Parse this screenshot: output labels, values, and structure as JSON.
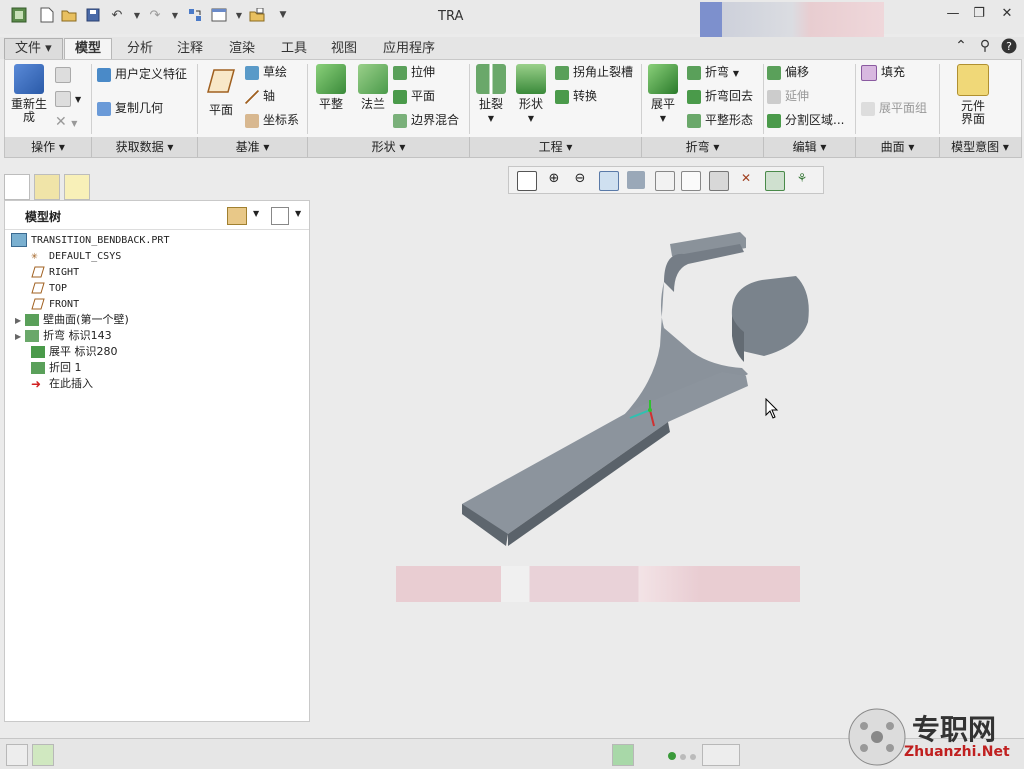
{
  "window": {
    "title": "TRA"
  },
  "tabs": [
    {
      "label": "文件"
    },
    {
      "label": "模型"
    },
    {
      "label": "分析"
    },
    {
      "label": "注释"
    },
    {
      "label": "渲染"
    },
    {
      "label": "工具"
    },
    {
      "label": "视图"
    },
    {
      "label": "应用程序"
    }
  ],
  "ribbon": {
    "regenerate": "重新生成",
    "user_defined_feature": "用户定义特征",
    "copy_geometry": "复制几何",
    "plane": "平面",
    "sketch": "草绘",
    "axis": "轴",
    "csys": "坐标系",
    "flat": "平整",
    "flange": "法兰",
    "extrude": "拉伸",
    "plane_small": "平面",
    "boundary_blend": "边界混合",
    "rip": "扯裂",
    "form": "形状",
    "corner_relief": "拐角止裂槽",
    "convert": "转换",
    "unbend": "展平",
    "bend": "折弯",
    "bend_back": "折弯回去",
    "flatten_form": "平整形态",
    "offset": "偏移",
    "extend": "延伸",
    "split_area": "分割区域...",
    "fill": "填充",
    "flat_pattern": "展平面组",
    "component_interface": "元件界面"
  },
  "groups": [
    "操作",
    "获取数据",
    "基准",
    "形状",
    "工程",
    "折弯",
    "编辑",
    "曲面",
    "模型意图"
  ],
  "model_tree": {
    "title": "模型树",
    "items": [
      {
        "label": "TRANSITION_BENDBACK.PRT",
        "icon": "part-icon"
      },
      {
        "label": "DEFAULT_CSYS",
        "icon": "csys-icon"
      },
      {
        "label": "RIGHT",
        "icon": "datum-plane-icon"
      },
      {
        "label": "TOP",
        "icon": "datum-plane-icon"
      },
      {
        "label": "FRONT",
        "icon": "datum-plane-icon"
      },
      {
        "label": "壁曲面(第一个壁)",
        "icon": "wall-icon"
      },
      {
        "label": "折弯 标识143",
        "icon": "bend-icon"
      },
      {
        "label": "展平 标识280",
        "icon": "unbend-icon"
      },
      {
        "label": "折回 1",
        "icon": "bendback-icon"
      },
      {
        "label": "在此插入",
        "icon": "insert-arrow-icon"
      }
    ]
  },
  "watermark": {
    "cn": "专职网",
    "en": "Zhuanzhi.Net"
  },
  "colors": {
    "model": "#7f8790",
    "accent_green": "#3a9a3a"
  }
}
